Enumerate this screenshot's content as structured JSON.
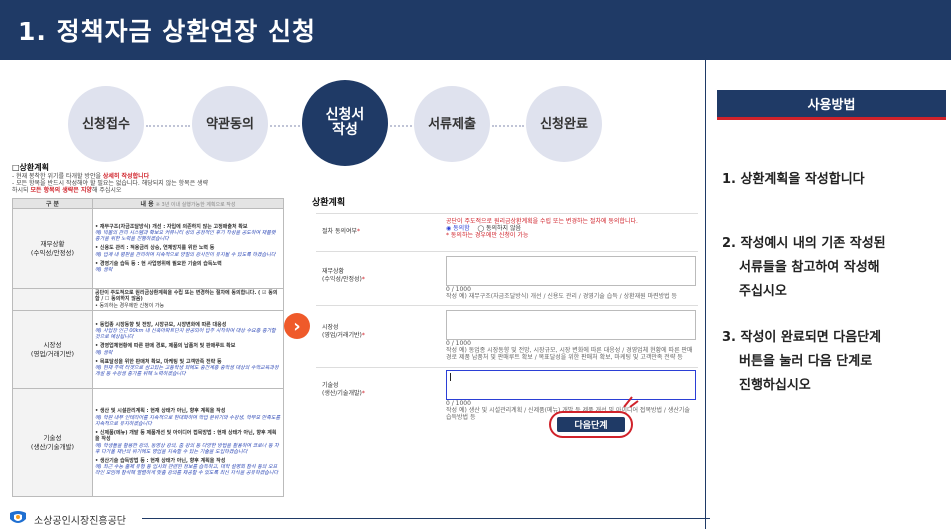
{
  "title": "1. 정책자금 상환연장 신청",
  "steps": [
    {
      "label": "신청접수"
    },
    {
      "label": "약관동의"
    },
    {
      "label": "신청서\n작성"
    },
    {
      "label": "서류제출"
    },
    {
      "label": "신청완료"
    }
  ],
  "doc": {
    "heading": "□상환계획",
    "note1_prefix": "- 현재 봉착한 위기를 타개할 방안을 ",
    "note1_emph": "상세히 작성합니다",
    "note2": "- 모든 항목을 반드시 작성해야 할 필요는 없습니다. 해당되지 않는 항목은 생략",
    "note3_prefix": "  하시되 ",
    "note3_emph": "모든 항목의 생략은 지양",
    "note3_suffix": "해 주십시오",
    "col_category": "구 분",
    "col_content": "내 용",
    "col_content_note": "※ 3년 이내 실행가능한 계획으로 작성",
    "rows": [
      {
        "category": "재무상황\n(수익성/안정성)",
        "items": [
          "• 재무구조(자금조달방식) 개선 : 자입에 의존하지 않는 고정매출처 확보",
          "예) 빅몰의 관리 시스템과 확보오 커뮤니티 성의 공정적인 후기 작성을 공도하여 재플랫 증가을 위한 노력을 진행하겠습니다",
          "• 신용도 관리 : 적용금리 상승, 연체방지를 위한 노력 등",
          "예) 업계 내 평판을 관리하여 지속적으로 양질의 강사진이 유지될 수 있도록 하겠습니다",
          "• 경영기술 습득 등 : 현 사업영위에 필요한 기술의 습득노력",
          "예) 생략"
        ]
      },
      {
        "category": "",
        "items": [
          "공단이 주도적으로 원리금상환계획을 수립 또는 변경하는 절차에 동의합니다. ( ☑ 동의함 / ☐ 동의하지 않음)",
          "• 동의하는 경우에만 신청이 가능"
        ]
      },
      {
        "category": "시장성\n(영업/거래기반)",
        "items": [
          "• 동업종 시장동향 및 전망, 시장규모, 시장변화에 따른 대응성",
          "예) 사업장 인근 00km 내 신축아파트단지 완공되어 입주 시작하며 대상 수요층 증가할 것으로 예상됩니다",
          "• 경영업체현황에 따른 판매 경로, 제품의 납품처 및 판매루트 확보",
          "예) 생략",
          "• 목표달성을 위한 판매처 확보, 마케팅 및 고객만족 전략 등",
          "예) 현재 주력 타겟으로 삼고있는 고등학생 외에도 중간계층 중학생 대상의 수학교육과정 개설 등 수강생 증가를 위해 노력하겠습니다"
        ]
      },
      {
        "category": "기술성\n(생산/기술개발)",
        "items": [
          "• 생산 및 시설관리계획 : 현재 상태가 아닌, 향후 계획을 작성",
          "예) 학원 내부 인테리어를 지속적으로 현대화하여 학업 분위기와 수강생, 학부모 만족도를 지속적으로 유지하겠습니다",
          "• 신제품(메뉴) 개발 등 제품개선 및 아이디어 접목방법 : 현재 상태가 아닌, 향후 계획을 작성",
          "예) 학생들을 활용한 강의, 동영상 강의, 줌 강의 등 다양한 방법을 활용하여 코로나 등 차후 다가올 재난의 위기에도 영업을 지속할 수 있는 기술을 도입하겠습니다",
          "• 생산기술 습득방법 등 : 현재 상태가 아닌, 향후 계획을 작성",
          "예) 최근 수능 출제 유형 등 입시와 관련된 정보를 습득하고, 대학 설명회 참석 등의 오프라인 모임에 참석해 열렬하게 맞춤 강의를 제공할 수 있도록 최신 자식을 공유하겠습니다"
        ]
      }
    ]
  },
  "form": {
    "title": "상환계획",
    "consent": {
      "label": "절차 동의여부",
      "req": "*",
      "desc": "공단이 주도적으로 원리금상환계획을 수립 또는 변경하는 절차에 동의합니다.",
      "agree": "◉ 동의함",
      "disagree": "◯ 동의하지 않음",
      "note": "* 동의하는 경우에만 신청이 가능"
    },
    "finance": {
      "label": "재무상황\n(수익성/안정성)",
      "req": "*",
      "count": "0 / 1000",
      "help": "작성 예) 재무구조(자금조달방식) 개선 / 신용도 관리 / 경영기술 습득 / 상환재원 마련방법 등"
    },
    "market": {
      "label": "시장성\n(영업/거래기반)",
      "req": "*",
      "count": "0 / 1000",
      "help": "작성 예) 동업종 시장동향 및 전망, 시장규모, 시장 변화에 따른 대응성 / 경영업체 현황에 따른 판매 경로 제품 납품처 및 판매루트 확보 / 목표달성을 위한 판매처 확보, 마케팅 및 고객만족 전략 등"
    },
    "tech": {
      "label": "기술성\n(생산/기술개발)",
      "req": "*",
      "count": "0 / 1000",
      "help": "작성 예) 생산 및 시설관리계획 / 신제품(메뉴) 개발 등 제품 개선 및 아이디어 접목방법 / 생산기술 습득방법 등"
    },
    "next_label": "다음단계"
  },
  "howto": {
    "title": "사용방법",
    "items": [
      {
        "line1": "1. 상환계획을 작성합니다",
        "line2": "",
        "line3": ""
      },
      {
        "line1": "2. 작성예시 내의 기존 작성된",
        "line2": "서류들을 참고하여 작성해",
        "line3": "주십시오"
      },
      {
        "line1": "3. 작성이 완료되면 다음단계",
        "line2": "버튼을 눌러 다음 단계로",
        "line3": "진행하십시오"
      }
    ]
  },
  "footer": {
    "org": "소상공인시장진흥공단"
  },
  "colors": {
    "navy": "#1f3a66",
    "red": "#d0222a",
    "orange": "#ef5a2a",
    "step_inactive": "#dfe2ee"
  }
}
